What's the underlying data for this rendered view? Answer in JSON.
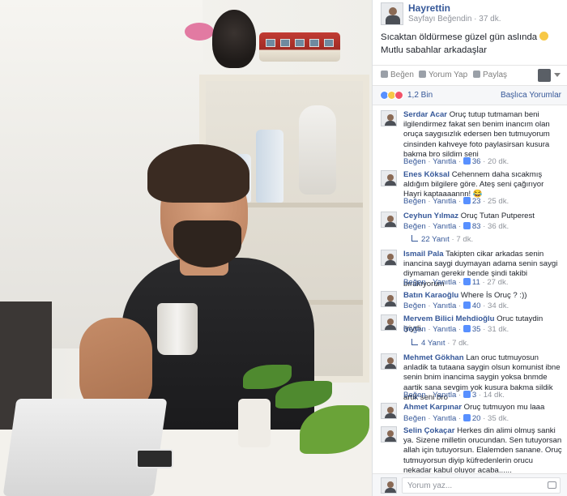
{
  "post": {
    "author": "Hayrettin",
    "page_like": "Sayfayı Beğendin",
    "time": "37 dk.",
    "text": "Sıcaktan öldürmese güzel gün aslında",
    "text_end": "Mutlu sabahlar arkadaşlar",
    "actions": {
      "like": "Beğen",
      "comment": "Yorum Yap",
      "share": "Paylaş"
    },
    "reactions_count": "1,2 Bin",
    "sort_label": "Başlıca Yorumlar"
  },
  "comment_ui": {
    "like": "Beğen",
    "reply": "Yanıtla",
    "sep": "·"
  },
  "comments": [
    {
      "name": "Serdar Acar",
      "text": "Oruç tutup tutmaman beni ilgilendirmez fakat sen benim inancım olan oruça saygısızlık edersen ben tutmuyorum cinsinden kahveye foto paylasirsan kusura bakma bro sildim seni",
      "likes": "36",
      "time": "20 dk."
    },
    {
      "name": "Enes Köksal",
      "text": "Cehennem daha sıcakmış aldığım bilgilere göre. Ateş seni çağırıyor Hayri kaptaaaannn! 😂",
      "likes": "23",
      "time": "25 dk."
    },
    {
      "name": "Ceyhun Yılmaz",
      "text": "Oruç Tutan Putperest",
      "likes": "83",
      "time": "36 dk."
    },
    {
      "name": "Ismail Pala",
      "text": "Takipten cikar arkadas senin inancina saygi duymayan adama senin saygi diymaman gerekir bende şindi takibi bırakıyorum",
      "likes": "11",
      "time": "27 dk."
    },
    {
      "name": "Batın Karaoğlu",
      "text": "Where İs Oruç ? :))",
      "likes": "40",
      "time": "34 dk."
    },
    {
      "name": "Mervem Bilici Mehdioğlu",
      "text": "Oruc tutaydin iyiydi.",
      "likes": "35",
      "time": "31 dk."
    },
    {
      "name": "Mehmet Gökhan",
      "text": "Lan oruc tutmuyosun anladik ta tutaana saygin olsun komunist ibne senin bnim inancima saygin yoksa bnmde aartik sana sevgim yok kusura bakma sildik artik seni bro",
      "likes": "3",
      "time": "14 dk."
    },
    {
      "name": "Ahmet Karpınar",
      "text": "Oruç tutmuyon mu laaa",
      "likes": "20",
      "time": "35 dk."
    },
    {
      "name": "Selin Çokaçar",
      "text": "Herkes din alimi olmuş sanki ya. Sizene milletin orucundan. Sen tutuyorsan allah için tutuyorsun. Elalemden sanane. Oruç tutmuyorsun diyip küfredenlerin orucu nekadar kabul oluyor acaba......"
    }
  ],
  "replies": [
    {
      "label": "22 Yanıt",
      "time": "7 dk."
    },
    {
      "label": "4 Yanıt",
      "time": "7 dk."
    }
  ],
  "composer": {
    "placeholder": "Yorum yaz..."
  },
  "icons": {
    "like": "thumbs-up-icon",
    "comment": "speech-bubble-icon",
    "share": "share-arrow-icon",
    "camera": "camera-icon"
  },
  "colors": {
    "link": "#365899",
    "meta": "#90949c",
    "text": "#1d2129",
    "like_blue": "#5890ff",
    "love_red": "#f25268",
    "haha_yellow": "#f7c846"
  }
}
